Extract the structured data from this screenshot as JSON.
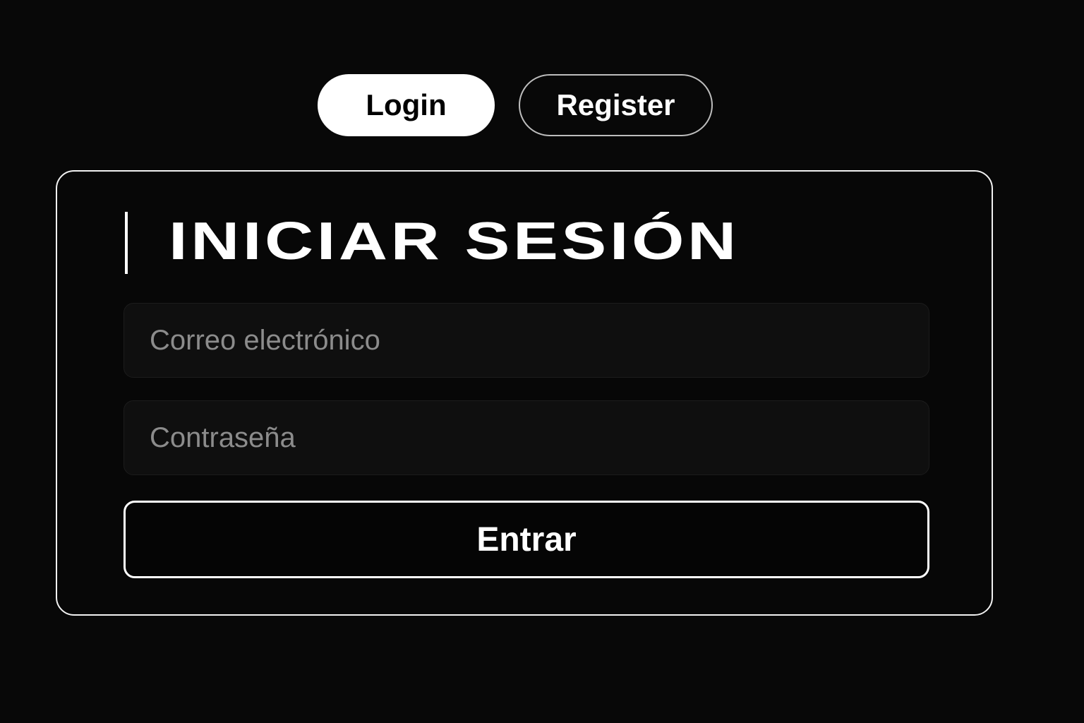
{
  "tabs": {
    "login_label": "Login",
    "register_label": "Register",
    "active": "login"
  },
  "login_form": {
    "title": "INICIAR SESIÓN",
    "email_placeholder": "Correo electrónico",
    "password_placeholder": "Contraseña",
    "submit_label": "Entrar"
  },
  "colors": {
    "background": "#080808",
    "accent": "#ffffff",
    "input_background": "#0f0f0f",
    "placeholder": "#8c8c8c"
  }
}
